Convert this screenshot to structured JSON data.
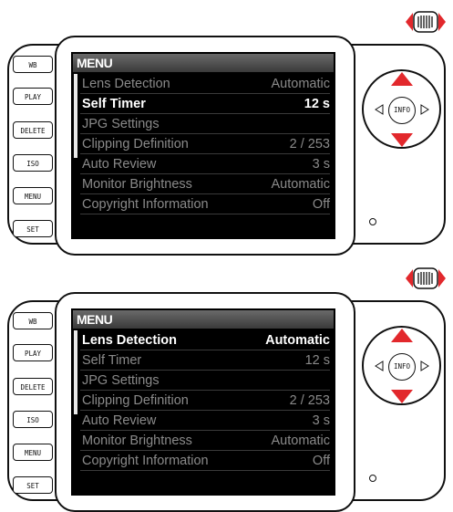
{
  "panels": [
    {
      "menu_title": "MENU",
      "side_buttons": [
        "WB",
        "PLAY",
        "DELETE",
        "ISO",
        "MENU",
        "SET"
      ],
      "info_label": "INFO",
      "selected_index": 1,
      "dial_red_arrows": [
        "up",
        "down"
      ],
      "items": [
        {
          "label": "Lens Detection",
          "value": "Automatic"
        },
        {
          "label": "Self Timer",
          "value": "12 s"
        },
        {
          "label": "JPG Settings",
          "value": ""
        },
        {
          "label": "Clipping Definition",
          "value": "2 / 253"
        },
        {
          "label": "Auto Review",
          "value": "3 s"
        },
        {
          "label": "Monitor Brightness",
          "value": "Automatic"
        },
        {
          "label": "Copyright Information",
          "value": "Off"
        }
      ]
    },
    {
      "menu_title": "MENU",
      "side_buttons": [
        "WB",
        "PLAY",
        "DELETE",
        "ISO",
        "MENU",
        "SET"
      ],
      "info_label": "INFO",
      "selected_index": 0,
      "dial_red_arrows": [
        "up",
        "down"
      ],
      "items": [
        {
          "label": "Lens Detection",
          "value": "Automatic"
        },
        {
          "label": "Self Timer",
          "value": "12 s"
        },
        {
          "label": "JPG Settings",
          "value": ""
        },
        {
          "label": "Clipping Definition",
          "value": "2 / 253"
        },
        {
          "label": "Auto Review",
          "value": "3 s"
        },
        {
          "label": "Monitor Brightness",
          "value": "Automatic"
        },
        {
          "label": "Copyright Information",
          "value": "Off"
        }
      ]
    }
  ],
  "colors": {
    "accent_red": "#e2282c",
    "selected_text": "#ffffff",
    "unselected_text": "#8a8a8a",
    "screen_bg": "#000000"
  },
  "icons": {
    "thumbwheel": "thumbwheel-icon"
  }
}
